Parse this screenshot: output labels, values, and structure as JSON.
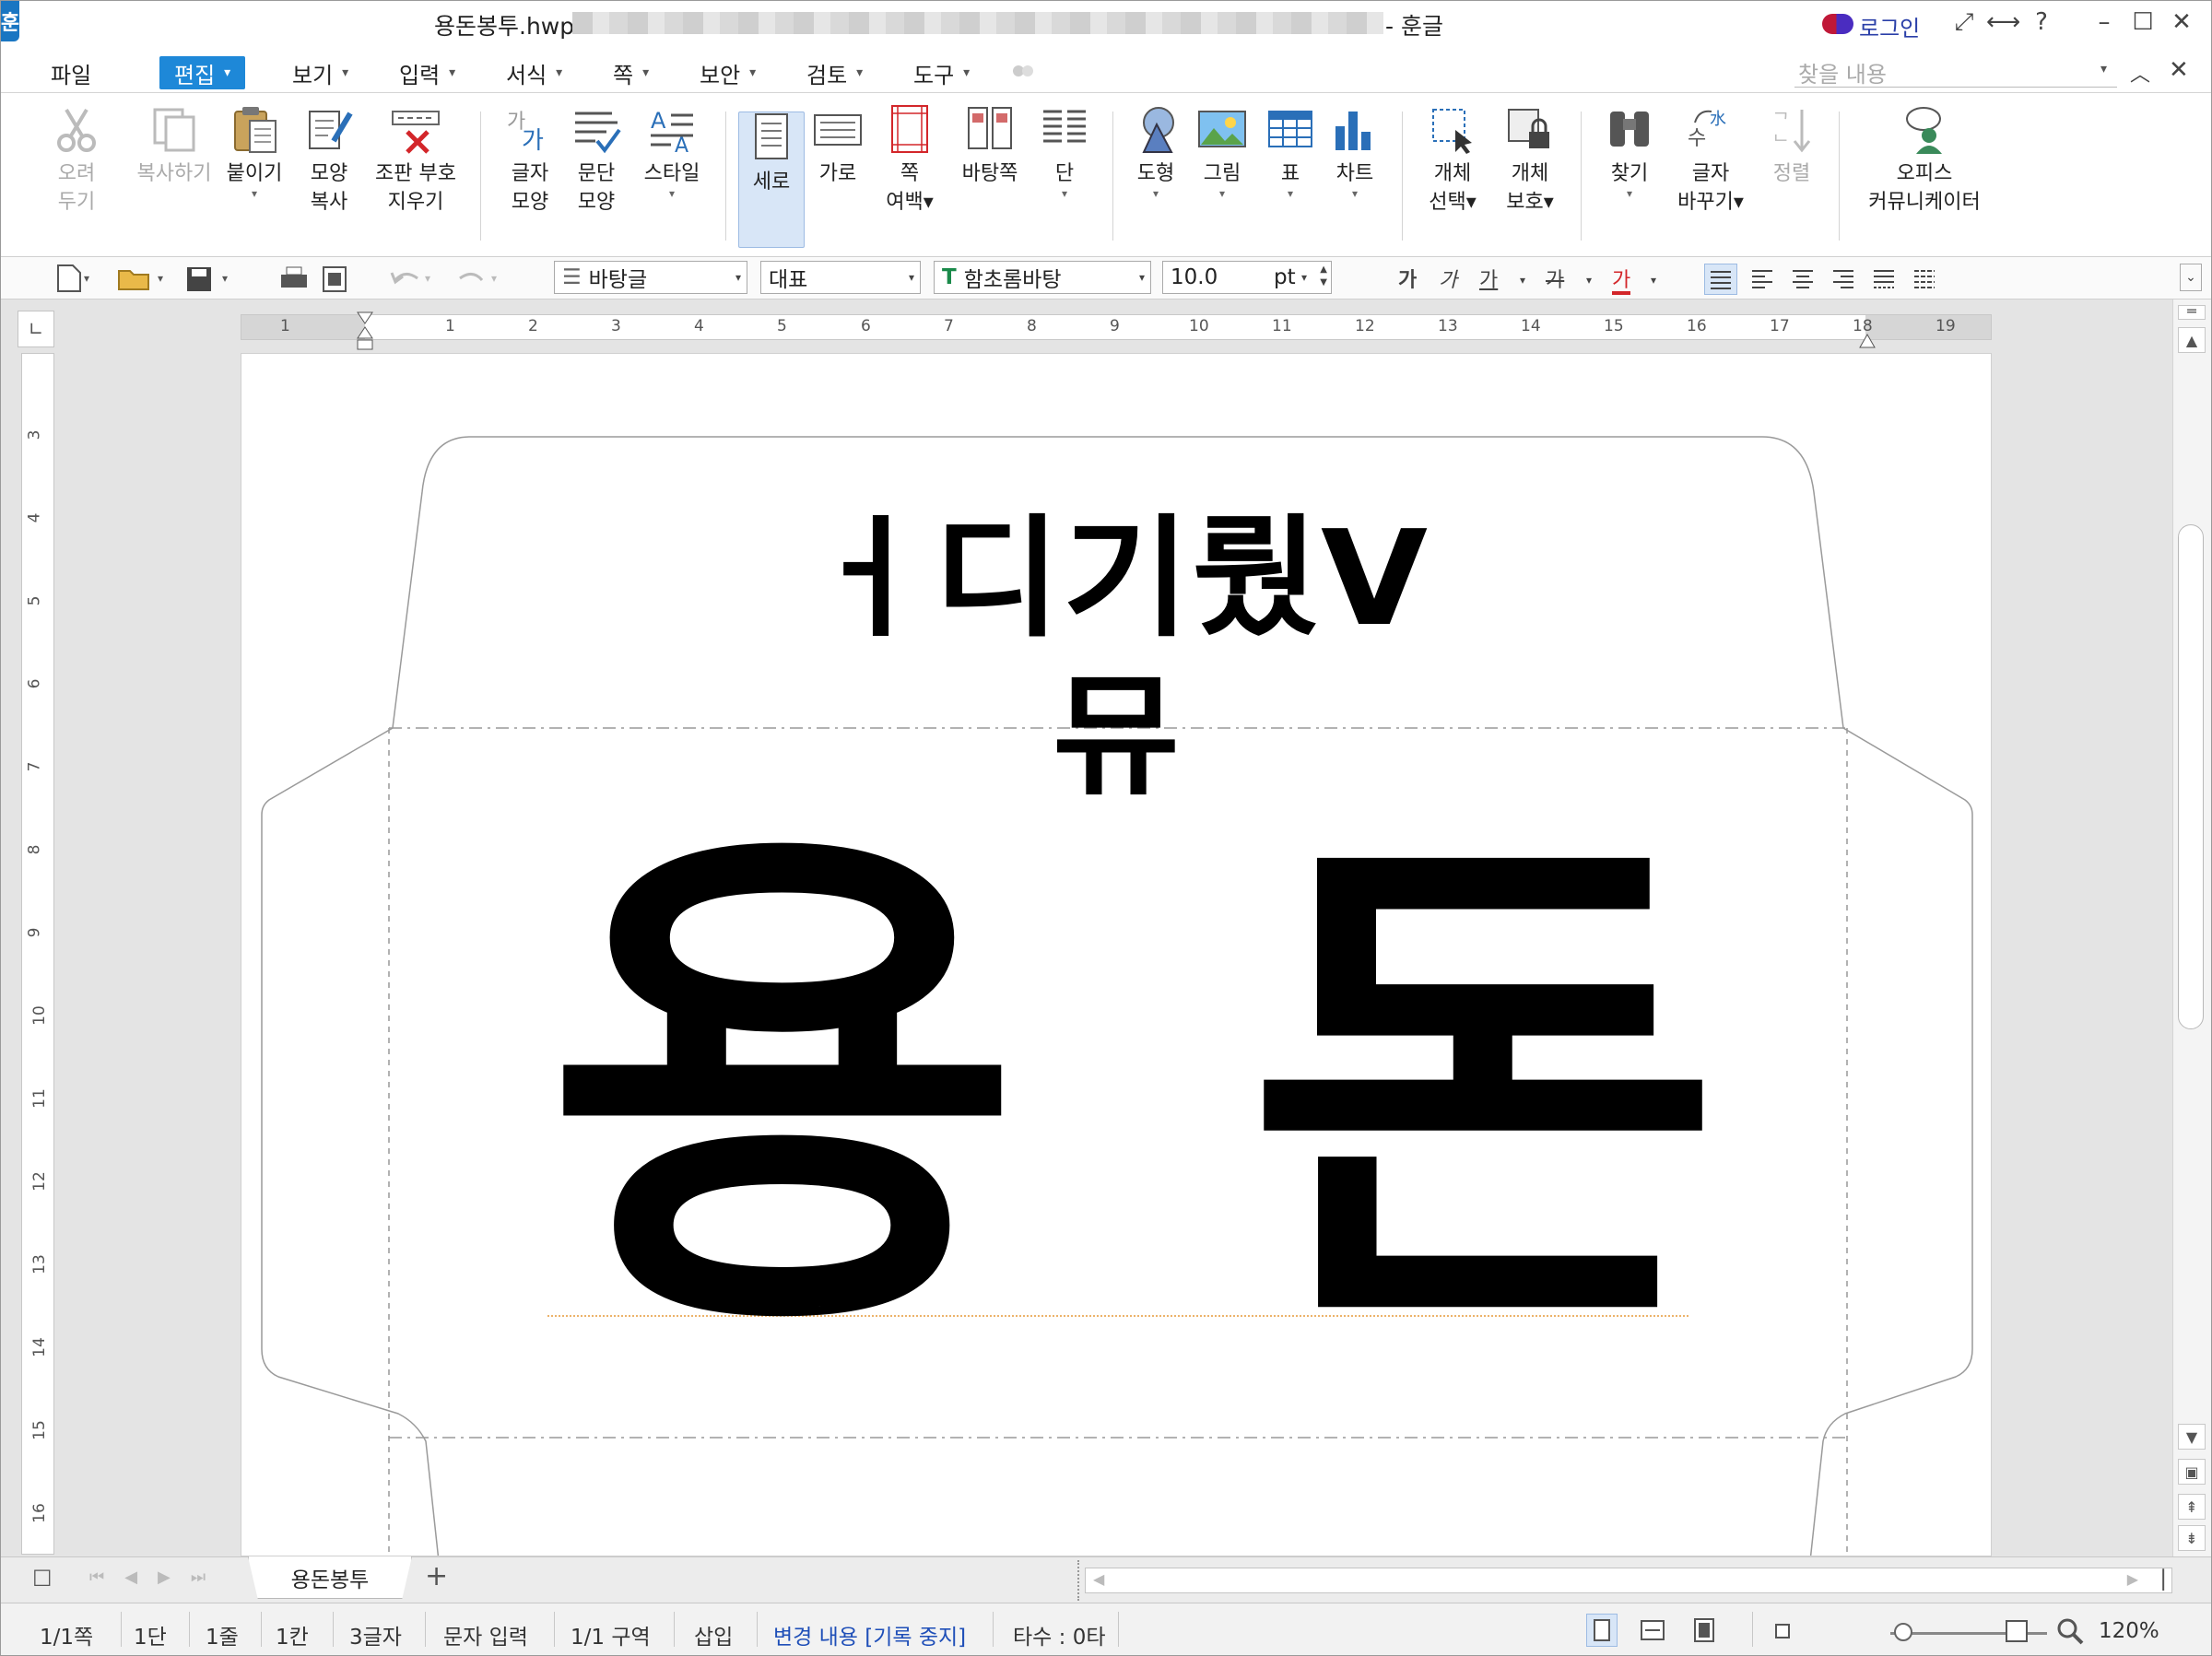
{
  "window": {
    "app_logo": "훈",
    "doc_title": "용돈봉투.hwp",
    "app_name": "- 훈글",
    "login_label": "로그인",
    "controls": {
      "fullscreen": "⤢",
      "width": "⟷",
      "help": "?",
      "minimize": "–",
      "maximize": "☐",
      "close": "✕"
    }
  },
  "menubar": {
    "items": [
      {
        "label": "파일",
        "arrow": ""
      },
      {
        "label": "편집",
        "arrow": "▾"
      },
      {
        "label": "보기",
        "arrow": "▾"
      },
      {
        "label": "입력",
        "arrow": "▾"
      },
      {
        "label": "서식",
        "arrow": "▾"
      },
      {
        "label": "쪽",
        "arrow": "▾"
      },
      {
        "label": "보안",
        "arrow": "▾"
      },
      {
        "label": "검토",
        "arrow": "▾"
      },
      {
        "label": "도구",
        "arrow": "▾"
      }
    ],
    "search_placeholder": "찾을 내용"
  },
  "ribbon": {
    "cut": {
      "l1": "오려",
      "l2": "두기"
    },
    "copy": {
      "l1": "복사하기",
      "l2": ""
    },
    "paste": {
      "l1": "붙이기",
      "l2": "▾"
    },
    "shape_copy": {
      "l1": "모양",
      "l2": "복사"
    },
    "clear_marks": {
      "l1": "조판 부호",
      "l2": "지우기"
    },
    "char_shape": {
      "l1": "글자",
      "l2": "모양"
    },
    "para_shape": {
      "l1": "문단",
      "l2": "모양"
    },
    "style": {
      "l1": "스타일",
      "l2": "▾"
    },
    "vertical": {
      "l1": "세로",
      "l2": ""
    },
    "horizontal": {
      "l1": "가로",
      "l2": ""
    },
    "margin": {
      "l1": "쪽",
      "l2": "여백▾"
    },
    "background_page": {
      "l1": "바탕쪽",
      "l2": ""
    },
    "column": {
      "l1": "단",
      "l2": "▾"
    },
    "shape": {
      "l1": "도형",
      "l2": "▾"
    },
    "picture": {
      "l1": "그림",
      "l2": "▾"
    },
    "table": {
      "l1": "표",
      "l2": "▾"
    },
    "chart": {
      "l1": "차트",
      "l2": "▾"
    },
    "object_select": {
      "l1": "개체",
      "l2": "선택▾"
    },
    "object_protect": {
      "l1": "개체",
      "l2": "보호▾"
    },
    "find": {
      "l1": "찾기",
      "l2": "▾"
    },
    "replace": {
      "l1": "글자",
      "l2": "바꾸기▾"
    },
    "sort": {
      "l1": "정렬",
      "l2": ""
    },
    "office": {
      "l1": "오피스",
      "l2": "커뮤니케이터"
    }
  },
  "toolbar": {
    "style_value": "바탕글",
    "lang_value": "대표",
    "font_value": "함초롬바탕",
    "size_value": "10.0",
    "size_unit": "pt",
    "bold": "가",
    "italic": "가",
    "underline": "가",
    "strike": "가",
    "color": "가"
  },
  "ruler": {
    "h_numbers": [
      "1",
      "1",
      "2",
      "3",
      "4",
      "5",
      "6",
      "7",
      "8",
      "9",
      "10",
      "11",
      "12",
      "13",
      "14",
      "15",
      "16",
      "17",
      "18",
      "19"
    ],
    "v_numbers": [
      "3",
      "4",
      "5",
      "6",
      "7",
      "8",
      "9",
      "10",
      "11",
      "12",
      "13",
      "14",
      "15",
      "16"
    ]
  },
  "document": {
    "flap_text": "ㅓ디기뤘V뮤",
    "main_text_1": "용",
    "main_text_2": "돈"
  },
  "tabs": {
    "sheet": "용돈봉투",
    "add": "+"
  },
  "statusbar": {
    "page": "1/1쪽",
    "column": "1단",
    "line": "1줄",
    "col": "1칸",
    "chars": "3글자",
    "mode": "문자 입력",
    "section": "1/1 구역",
    "insert": "삽입",
    "track": "변경 내용 [기록 중지]",
    "typing": "타수 : 0타",
    "zoom": "120%"
  },
  "colors": {
    "accent": "#1e88d8",
    "track_text": "#1f4fb8"
  }
}
